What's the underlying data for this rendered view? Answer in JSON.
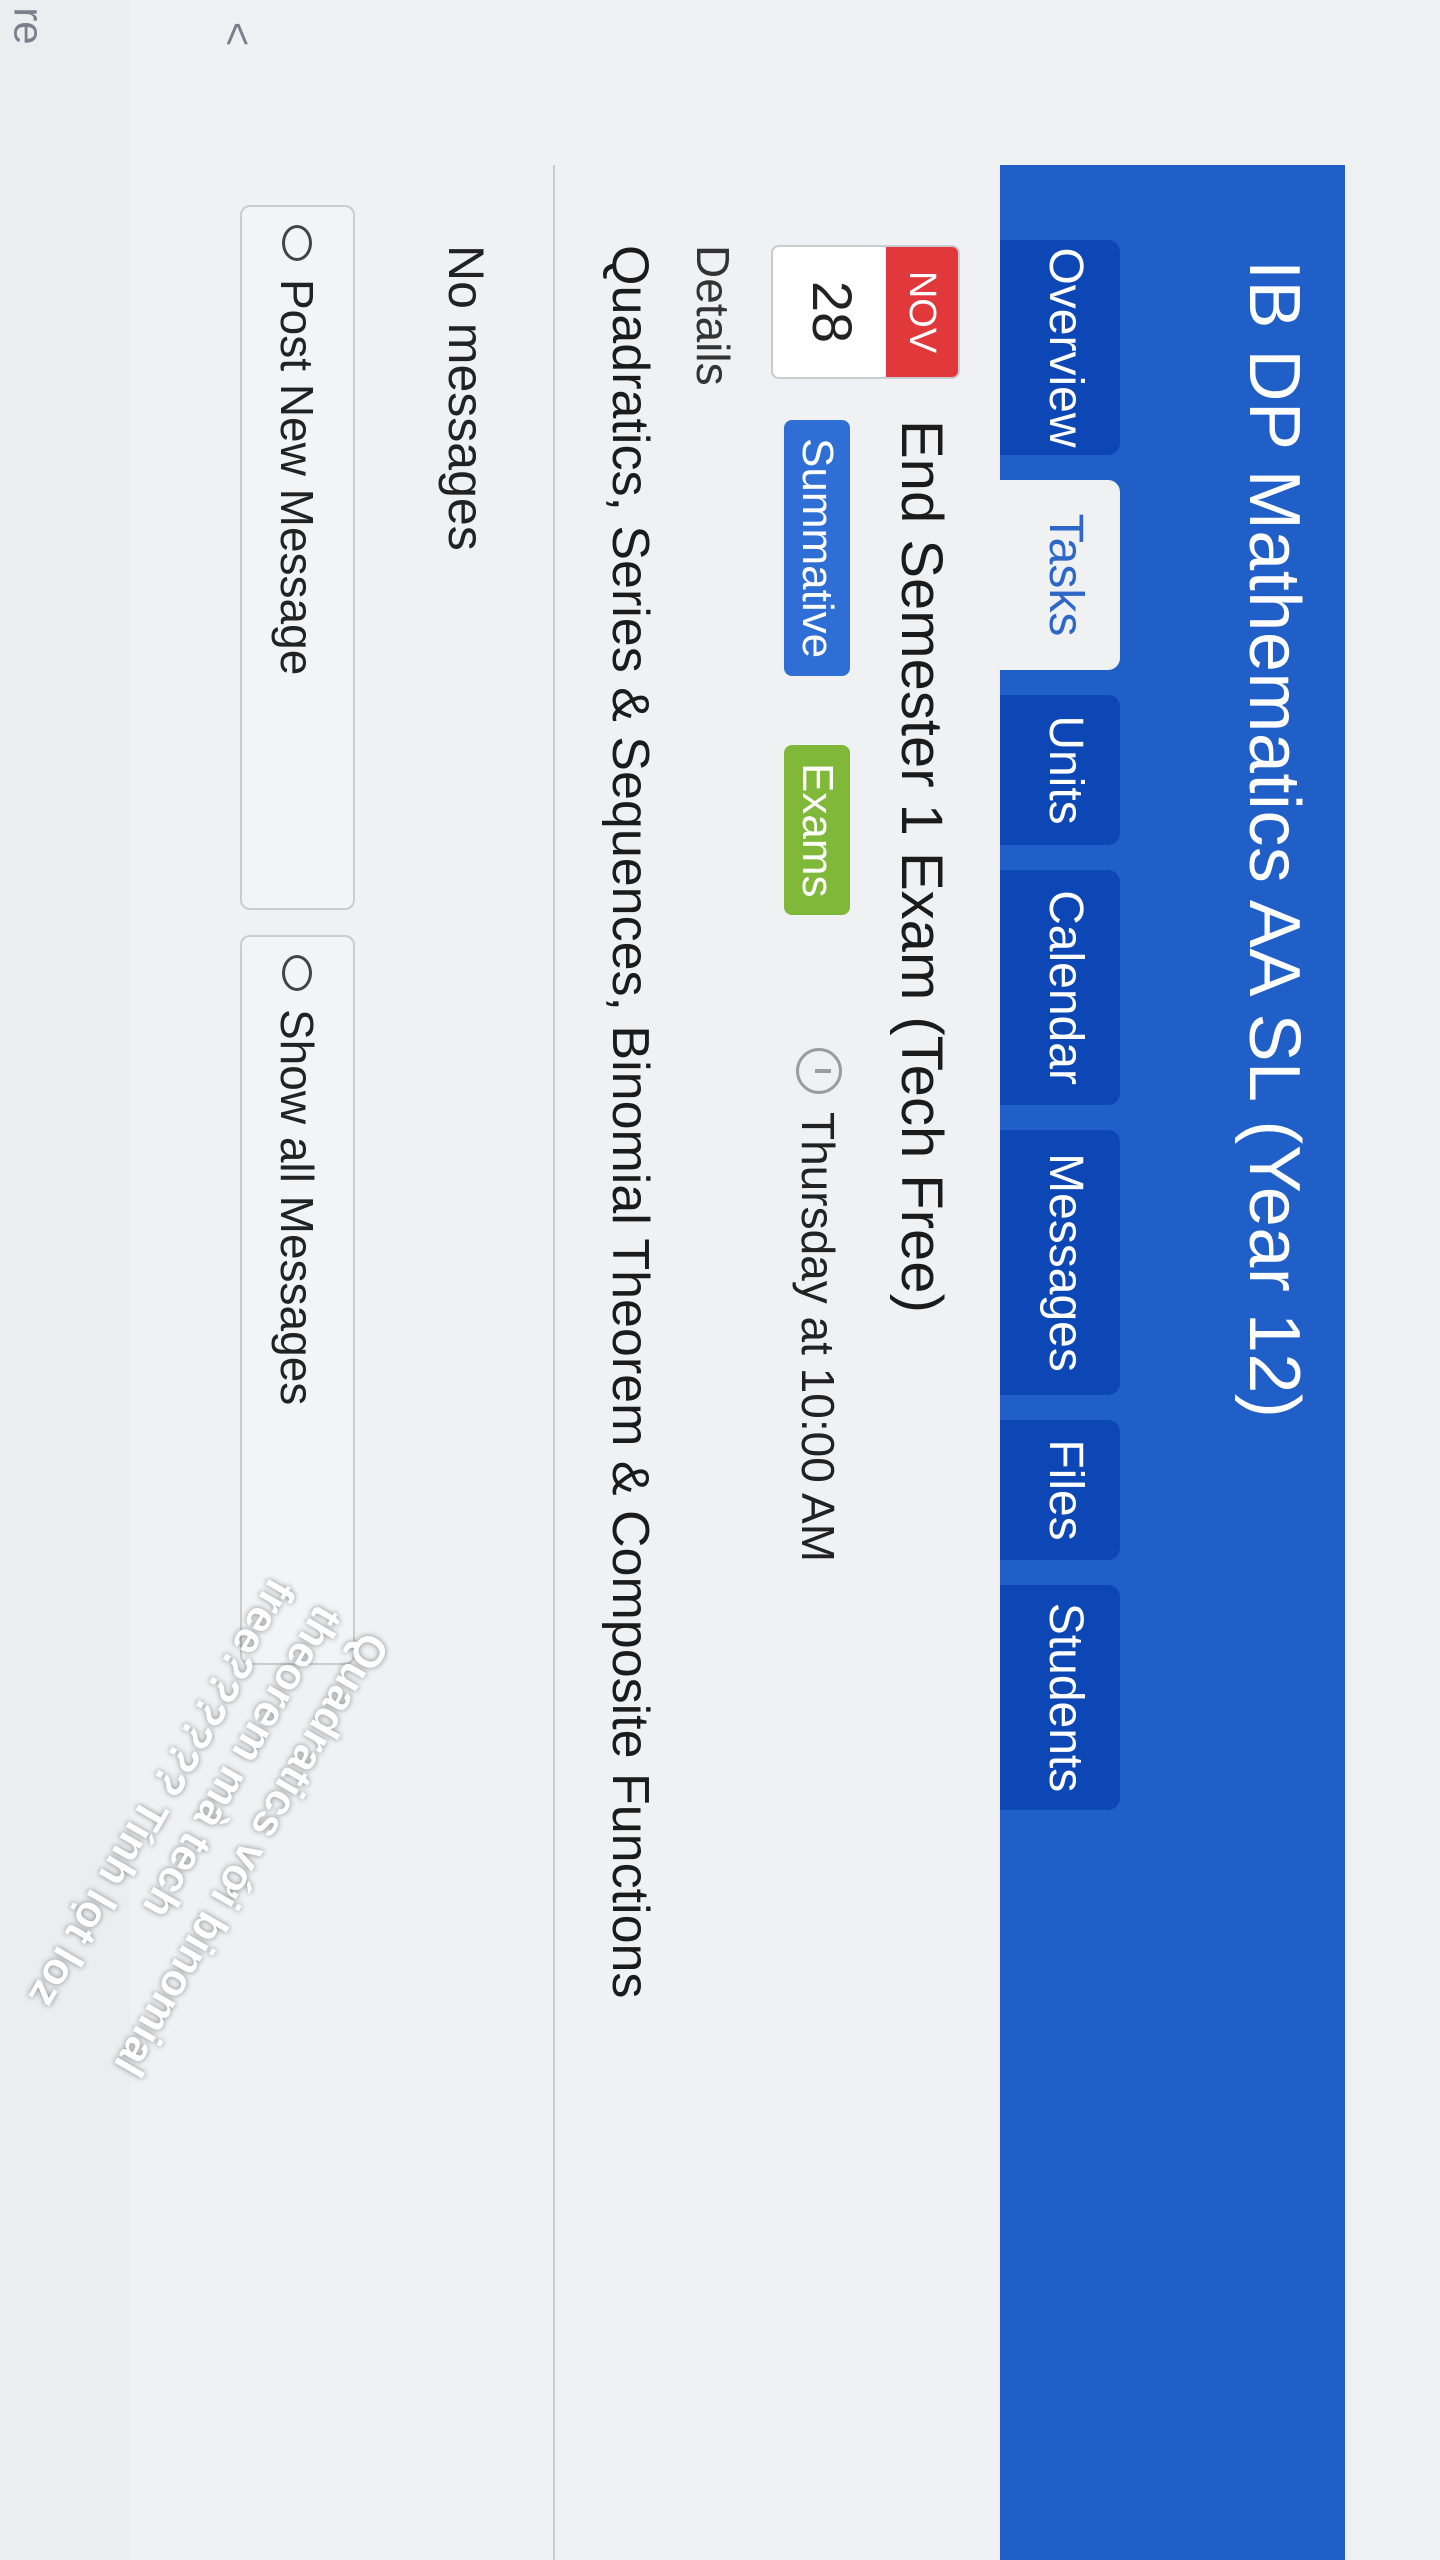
{
  "course": {
    "title": "IB DP Mathematics AA SL (Year 12)"
  },
  "tabs": [
    {
      "label": "Overview",
      "active": false
    },
    {
      "label": "Tasks",
      "active": true
    },
    {
      "label": "Units",
      "active": false
    },
    {
      "label": "Calendar",
      "active": false
    },
    {
      "label": "Messages",
      "active": false
    },
    {
      "label": "Files",
      "active": false
    },
    {
      "label": "Students",
      "active": false
    }
  ],
  "event": {
    "month": "NOV",
    "day": "28",
    "title": "End Semester 1 Exam (Tech Free)",
    "tags": [
      "Summative",
      "Exams"
    ],
    "time": "Thursday at 10:00 AM",
    "details_label": "Details",
    "details_text": "Quadratics, Series & Sequences, Binomial Theorem & Composite Functions"
  },
  "messages": {
    "empty_text": "No messages",
    "post_button": "Post New Message",
    "show_button": "Show all Messages"
  },
  "overlay_caption": {
    "line1": "Quadratics với binomial",
    "line2": "theorem mà tech",
    "line3": "free?????? Tính lọt loz"
  },
  "bezel": {
    "glyph_top": "re",
    "chevron": "<"
  },
  "colors": {
    "header": "#1f5fc7",
    "tab": "#0d47b6",
    "active_tab_text": "#2d68c8",
    "date_month": "#e0383b",
    "summative": "#2f6fd5",
    "exams": "#80b83a"
  }
}
